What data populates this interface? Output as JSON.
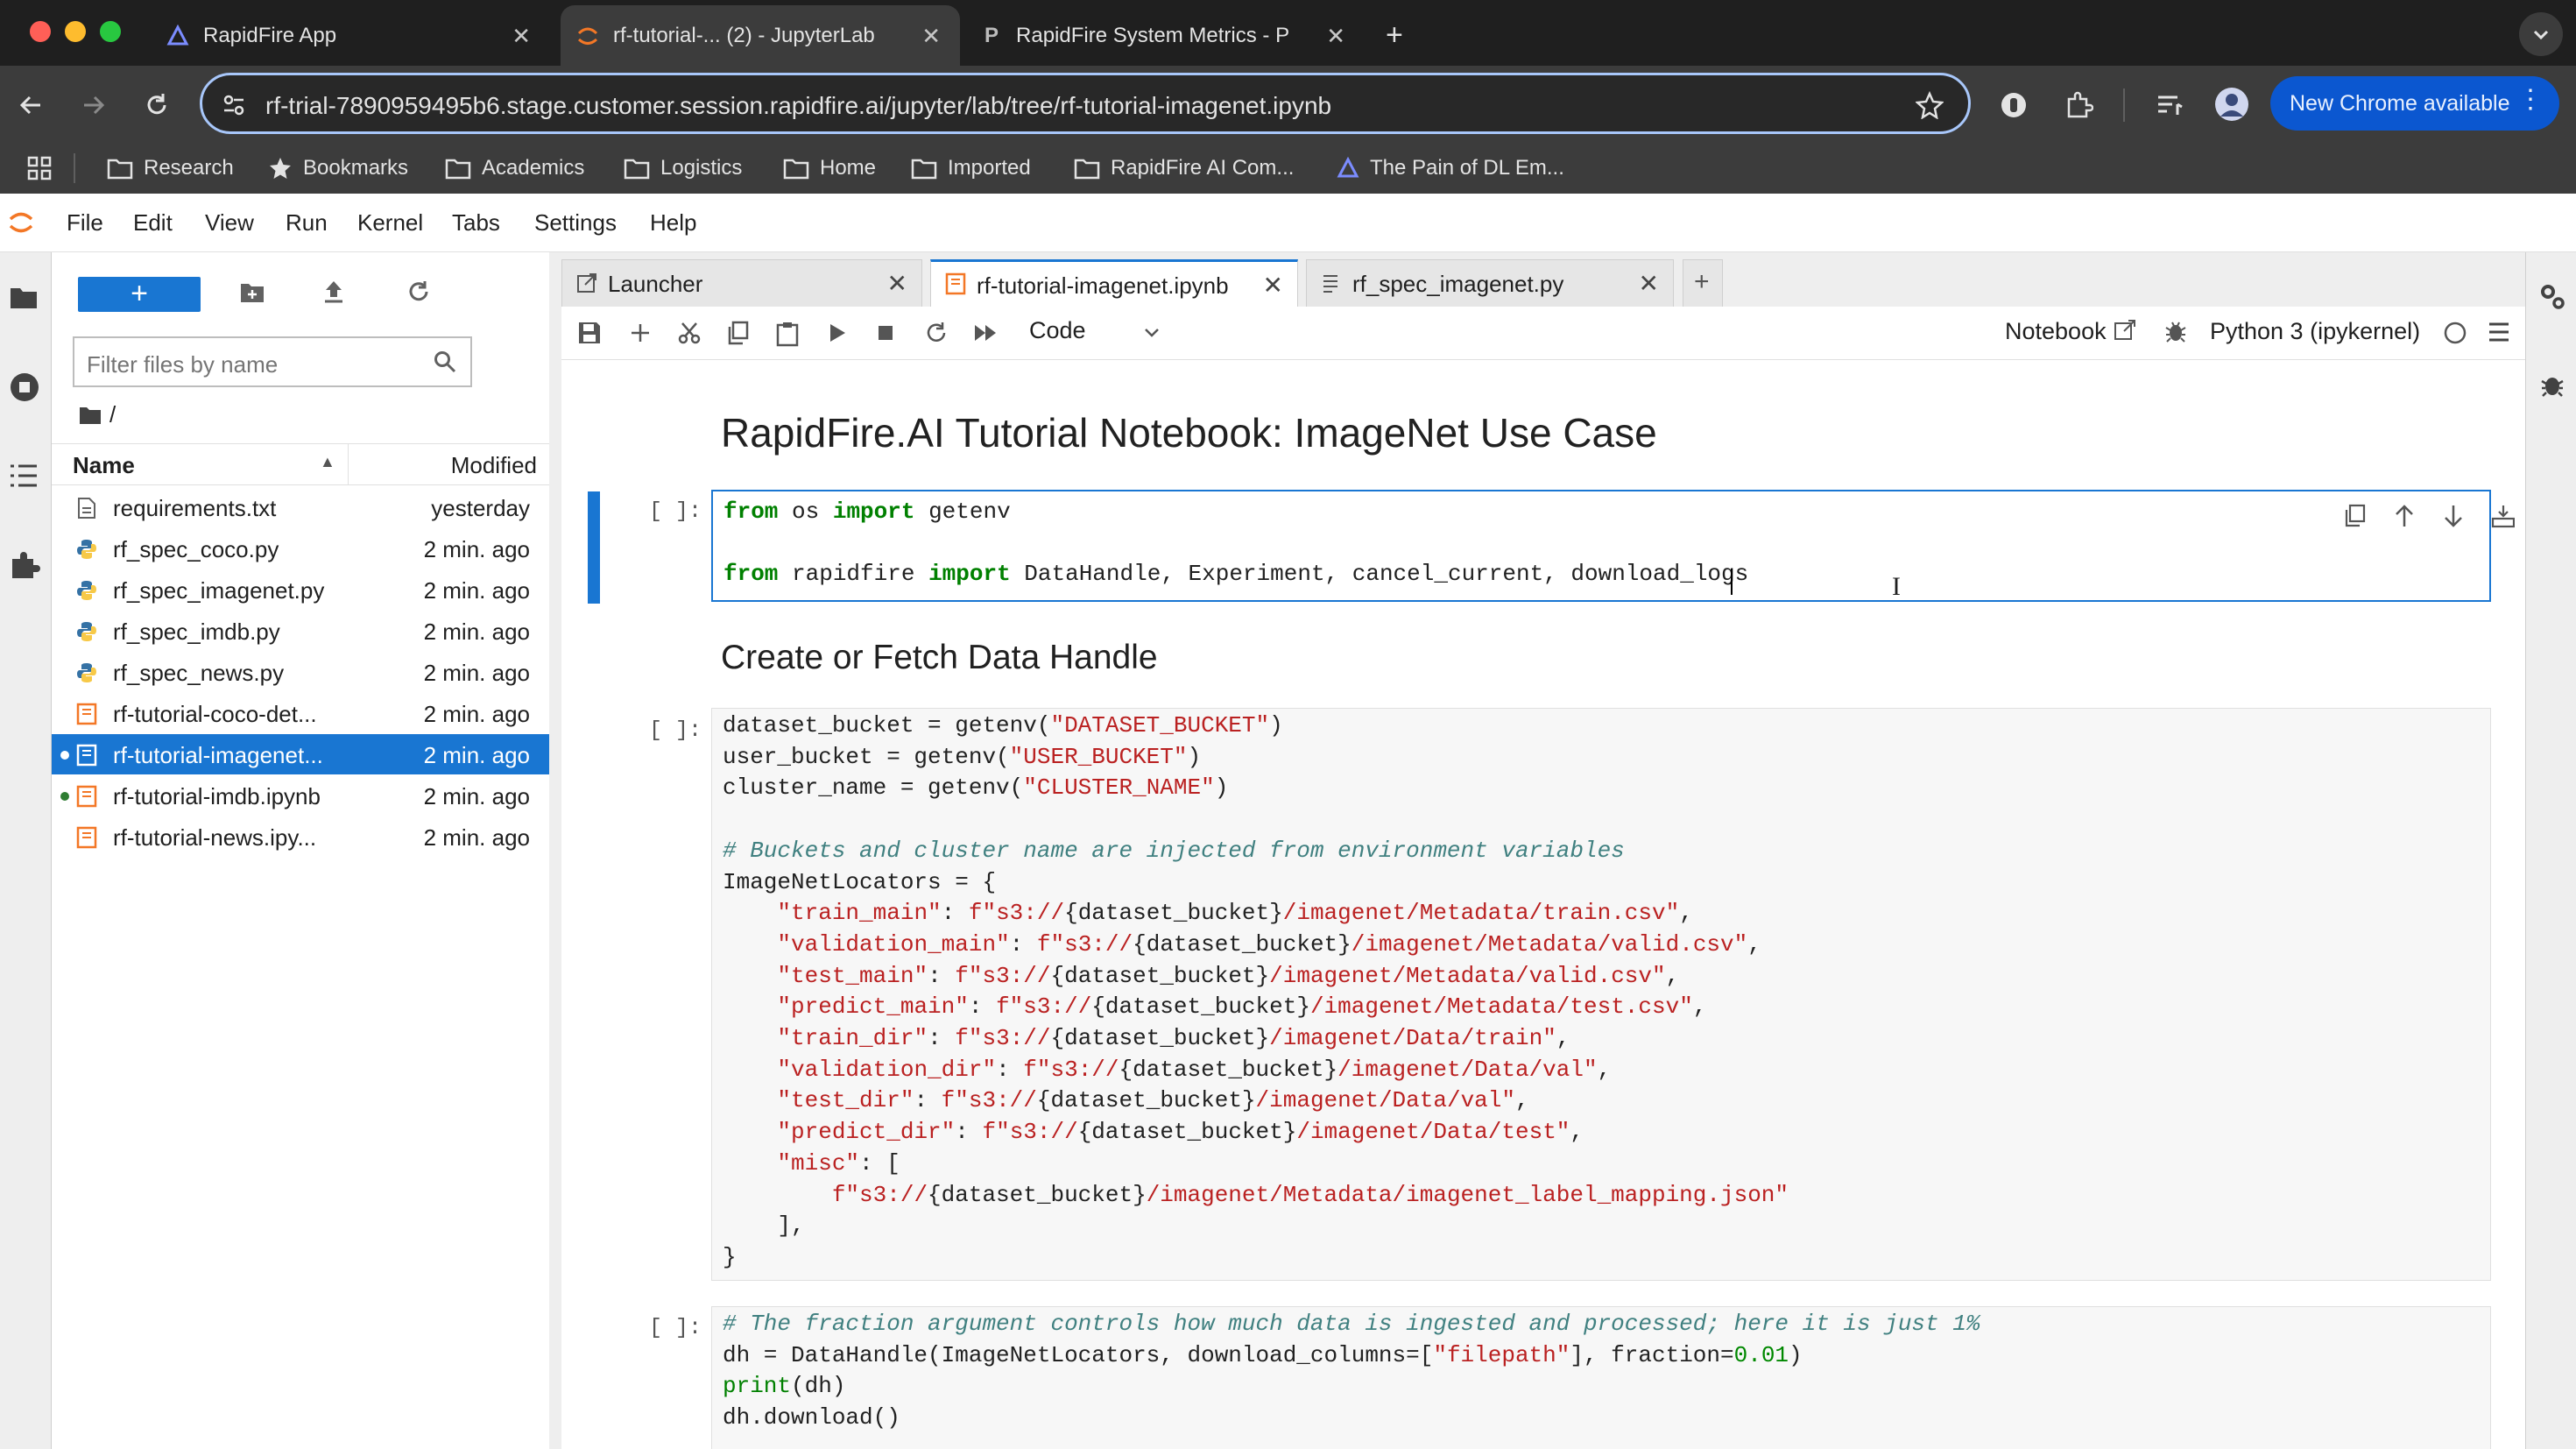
{
  "browser": {
    "tabs": [
      {
        "title": "RapidFire App"
      },
      {
        "title": "rf-tutorial-... (2) - JupyterLab"
      },
      {
        "title": "RapidFire System Metrics - P"
      }
    ],
    "url": "rf-trial-7890959495b6.stage.customer.session.rapidfire.ai/jupyter/lab/tree/rf-tutorial-imagenet.ipynb",
    "new_chrome_label": "New Chrome available",
    "bookmarks": [
      "Research",
      "Bookmarks",
      "Academics",
      "Logistics",
      "Home",
      "Imported",
      "RapidFire AI Com...",
      "The Pain of DL Em..."
    ]
  },
  "menu": [
    "File",
    "Edit",
    "View",
    "Run",
    "Kernel",
    "Tabs",
    "Settings",
    "Help"
  ],
  "filebrowser": {
    "filter_placeholder": "Filter files by name",
    "path": "/",
    "col_name": "Name",
    "col_modified": "Modified",
    "files": [
      {
        "name": "requirements.txt",
        "modified": "yesterday",
        "type": "text"
      },
      {
        "name": "rf_spec_coco.py",
        "modified": "2 min. ago",
        "type": "python"
      },
      {
        "name": "rf_spec_imagenet.py",
        "modified": "2 min. ago",
        "type": "python"
      },
      {
        "name": "rf_spec_imdb.py",
        "modified": "2 min. ago",
        "type": "python"
      },
      {
        "name": "rf_spec_news.py",
        "modified": "2 min. ago",
        "type": "python"
      },
      {
        "name": "rf-tutorial-coco-det...",
        "modified": "2 min. ago",
        "type": "notebook"
      },
      {
        "name": "rf-tutorial-imagenet...",
        "modified": "2 min. ago",
        "type": "notebook",
        "selected": true
      },
      {
        "name": "rf-tutorial-imdb.ipynb",
        "modified": "2 min. ago",
        "type": "notebook"
      },
      {
        "name": "rf-tutorial-news.ipy...",
        "modified": "2 min. ago",
        "type": "notebook"
      }
    ]
  },
  "dock_tabs": [
    "Launcher",
    "rf-tutorial-imagenet.ipynb",
    "rf_spec_imagenet.py"
  ],
  "nb_toolbar": {
    "cell_type": "Code",
    "notebook_label": "Notebook",
    "kernel": "Python 3 (ipykernel)"
  },
  "notebook": {
    "title": "RapidFire.AI Tutorial Notebook: ImageNet Use Case",
    "section": "Create or Fetch Data Handle",
    "prompt": "[ ]:"
  },
  "colors": {
    "accent": "#1976d2",
    "chrome_bg": "#1f1f1f",
    "keyword": "#008000",
    "string": "#ba2121",
    "comment": "#408080"
  }
}
